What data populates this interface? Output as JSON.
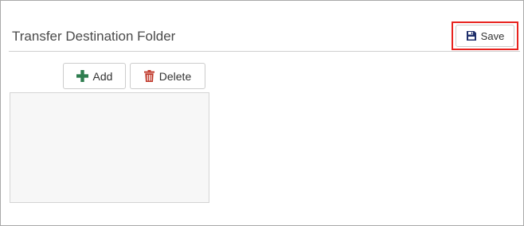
{
  "header": {
    "title": "Transfer Destination Folder",
    "save_label": "Save",
    "save_icon": "floppy-disk-icon"
  },
  "toolbar": {
    "add_label": "Add",
    "add_icon": "plus-icon",
    "delete_label": "Delete",
    "delete_icon": "trash-icon"
  },
  "folder_list": {
    "items": []
  },
  "colors": {
    "add_icon": "#2e7d4f",
    "delete_icon": "#c0392b",
    "save_icon": "#1f2f6b",
    "highlight": "#e8231f"
  }
}
